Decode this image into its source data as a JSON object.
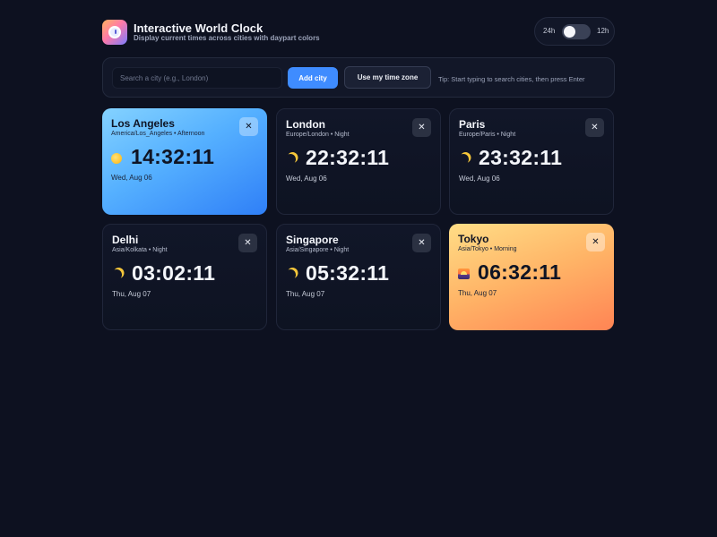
{
  "header": {
    "title": "Interactive World Clock",
    "subtitle": "Display current times across cities with daypart colors"
  },
  "format_toggle": {
    "left_label": "24h",
    "right_label": "12h",
    "selected": "24h"
  },
  "search": {
    "placeholder": "Search a city (e.g., London)",
    "value": "",
    "add_label": "Add city",
    "tz_label": "Use my time zone",
    "tip": "Tip: Start typing to search cities, then press Enter"
  },
  "cards": [
    {
      "city": "Los Angeles",
      "meta": "America/Los_Angeles • Afternoon",
      "time": "14:32:11",
      "date": "Wed, Aug 06",
      "icon": "sun-icon",
      "daypart": "Afternoon"
    },
    {
      "city": "London",
      "meta": "Europe/London • Night",
      "time": "22:32:11",
      "date": "Wed, Aug 06",
      "icon": "moon-icon",
      "daypart": "Night"
    },
    {
      "city": "Paris",
      "meta": "Europe/Paris • Night",
      "time": "23:32:11",
      "date": "Wed, Aug 06",
      "icon": "moon-icon",
      "daypart": "Night"
    },
    {
      "city": "Delhi",
      "meta": "Asia/Kolkata • Night",
      "time": "03:02:11",
      "date": "Thu, Aug 07",
      "icon": "moon-icon",
      "daypart": "Night"
    },
    {
      "city": "Singapore",
      "meta": "Asia/Singapore • Night",
      "time": "05:32:11",
      "date": "Thu, Aug 07",
      "icon": "moon-icon",
      "daypart": "Night"
    },
    {
      "city": "Tokyo",
      "meta": "Asia/Tokyo • Morning",
      "time": "06:32:11",
      "date": "Thu, Aug 07",
      "icon": "sunrise-icon",
      "daypart": "Morning"
    }
  ],
  "colors": {
    "background": "#0d1120",
    "accent": "#3f8cff",
    "afternoon": "#55b0ff",
    "morning": "#ffb366"
  }
}
